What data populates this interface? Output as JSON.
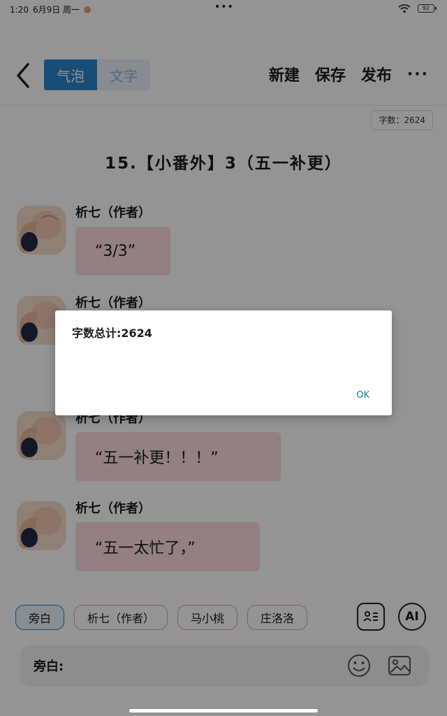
{
  "status_bar": {
    "time": "1:20",
    "date": "6月9日 周一",
    "center_dots": "•••",
    "battery": "92"
  },
  "toolbar": {
    "mode_tabs": [
      "气泡",
      "文字"
    ],
    "actions": [
      "新建",
      "保存",
      "发布"
    ],
    "more": "···"
  },
  "word_count_badge": "字数：2624",
  "chapter_title": "15.【小番外】3（五一补更）",
  "messages": [
    {
      "sender": "析七（作者）",
      "text": "“3/3”"
    },
    {
      "sender": "析七（作者）",
      "text": ""
    },
    {
      "sender": "析七（作者）",
      "text": "“五一补更！！！”"
    },
    {
      "sender": "析七（作者）",
      "text": "“五一太忙了，”"
    }
  ],
  "roles": [
    "旁白",
    "析七（作者）",
    "马小桃",
    "庄洛洛"
  ],
  "ai_label": "AI",
  "input": {
    "label": "旁白:"
  },
  "dialog": {
    "message": "字数总计:2624",
    "ok_label": "OK"
  },
  "colors": {
    "accent": "#2a86ce",
    "bubble": "#fcdde0",
    "chip_border": "#e0a7ad",
    "dialog_button": "#17808a"
  },
  "icons": {
    "back": "chevron-left-icon",
    "wifi": "wifi-icon",
    "battery": "battery-icon",
    "contacts": "contact-card-icon",
    "emoji": "smiley-icon",
    "image": "image-icon",
    "avatar": "avatar-illustration"
  }
}
